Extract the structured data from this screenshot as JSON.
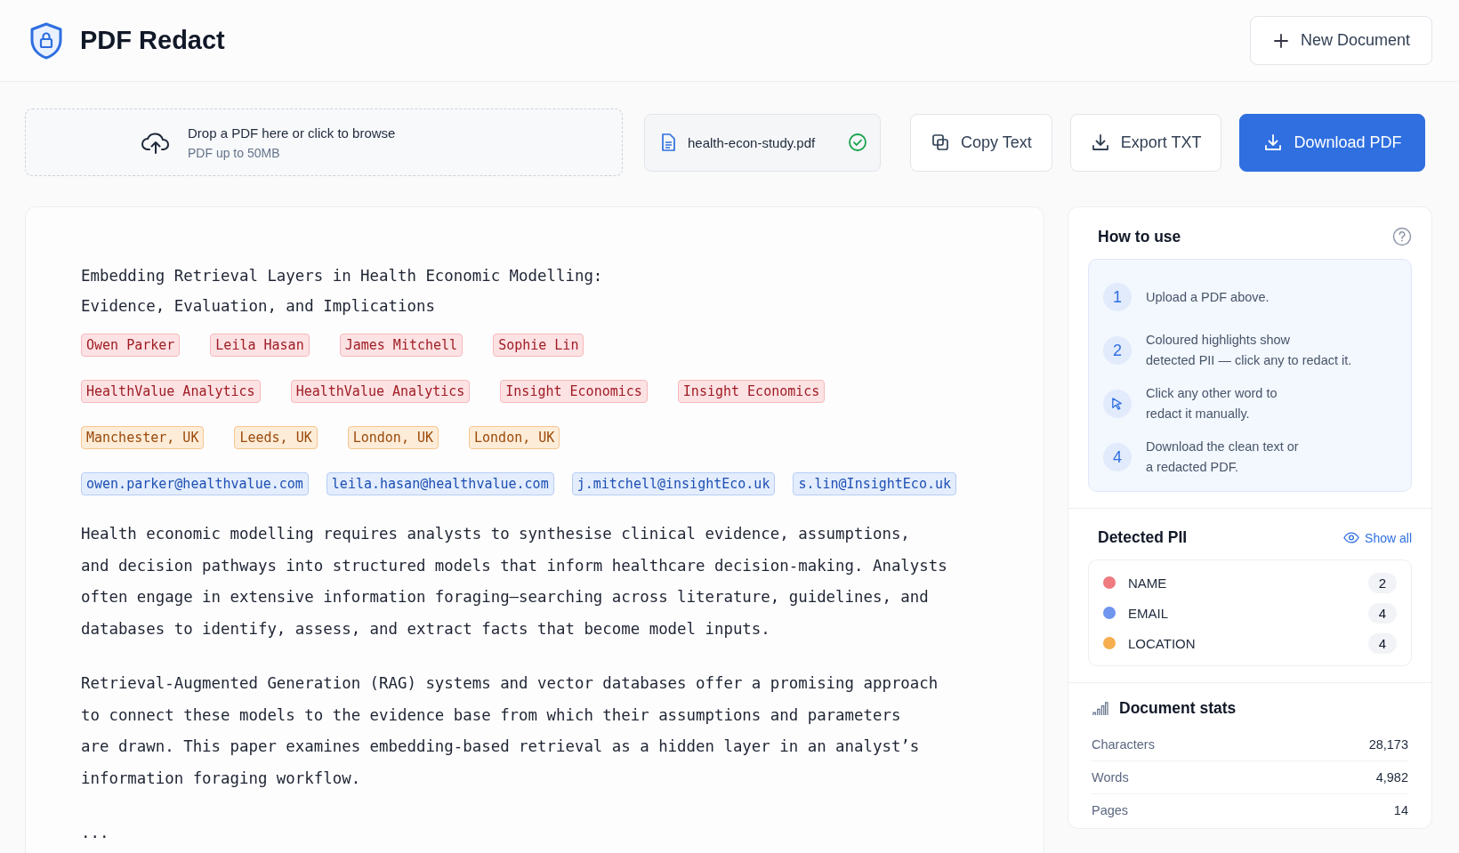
{
  "app": {
    "title": "PDF Redact",
    "new_button": "New Document"
  },
  "upload": {
    "title": "Drop a PDF here or click to browse",
    "hint": "PDF up to 50MB"
  },
  "file": {
    "name": "health-econ-study.pdf",
    "verified": true
  },
  "actions": [
    {
      "label": "Copy Text",
      "kind": "copy",
      "primary": false
    },
    {
      "label": "Export TXT",
      "kind": "download",
      "primary": false
    },
    {
      "label": "Download PDF",
      "kind": "download",
      "primary": true
    }
  ],
  "document": {
    "title_lines": [
      "Embedding Retrieval Layers in Health Economic Modelling:",
      "Evidence, Evaluation, and Implications"
    ],
    "chip_rows": [
      [
        {
          "text": "Owen Parker",
          "kind": "name"
        },
        {
          "text": "Leila Hasan",
          "kind": "name"
        },
        {
          "text": "James Mitchell",
          "kind": "name"
        },
        {
          "text": "Sophie Lin",
          "kind": "name"
        }
      ],
      [
        {
          "text": "HealthValue Analytics",
          "kind": "name"
        },
        {
          "text": "HealthValue Analytics",
          "kind": "name"
        },
        {
          "text": "Insight Economics",
          "kind": "name"
        },
        {
          "text": "Insight Economics",
          "kind": "name"
        }
      ],
      [
        {
          "text": "Manchester, UK",
          "kind": "location"
        },
        {
          "text": "Leeds, UK",
          "kind": "location"
        },
        {
          "text": "London, UK",
          "kind": "location"
        },
        {
          "text": "London, UK",
          "kind": "location"
        }
      ],
      [
        {
          "text": "owen.parker@healthvalue.com",
          "kind": "email"
        },
        {
          "text": "leila.hasan@healthvalue.com",
          "kind": "email"
        },
        {
          "text": "j.mitchell@insightEco.uk",
          "kind": "email"
        },
        {
          "text": "s.lin@InsightEco.uk",
          "kind": "email"
        }
      ]
    ],
    "paragraphs": [
      [
        "Health economic modelling requires analysts to synthesise clinical evidence, assumptions,",
        "and decision pathways into structured models that inform healthcare decision-making. Analysts",
        "often engage in extensive information foraging—searching across literature, guidelines, and",
        "databases to identify, assess, and extract facts that become model inputs."
      ],
      [
        "Retrieval-Augmented Generation (RAG) systems and vector databases offer a promising approach",
        "to connect these models to the evidence base from which their assumptions and parameters",
        "are drawn. This paper examines embedding-based retrieval as a hidden layer in an analyst’s",
        "information foraging workflow."
      ],
      [
        "..."
      ]
    ]
  },
  "how_to_use": {
    "title": "How to use",
    "steps": [
      {
        "kind": "number",
        "marker": "1",
        "lines": [
          "Upload a PDF above."
        ]
      },
      {
        "kind": "number",
        "marker": "2",
        "lines": [
          "Coloured highlights show",
          "detected PII — click any to redact it."
        ]
      },
      {
        "kind": "cursor",
        "lines": [
          "Click any other word to",
          "redact it manually."
        ]
      },
      {
        "kind": "number",
        "marker": "4",
        "lines": [
          "Download the clean text or",
          "a redacted PDF."
        ]
      }
    ]
  },
  "detected_pii": {
    "title": "Detected PII",
    "show_all": "Show all",
    "items": [
      {
        "label": "NAME",
        "count": "2",
        "color": "#ef7a80"
      },
      {
        "label": "EMAIL",
        "count": "4",
        "color": "#6f95ef"
      },
      {
        "label": "LOCATION",
        "count": "4",
        "color": "#f7ae4f"
      }
    ]
  },
  "stats": {
    "title": "Document stats",
    "rows": [
      {
        "label": "Characters",
        "value": "28,173"
      },
      {
        "label": "Words",
        "value": "4,982"
      },
      {
        "label": "Pages",
        "value": "14"
      }
    ]
  }
}
